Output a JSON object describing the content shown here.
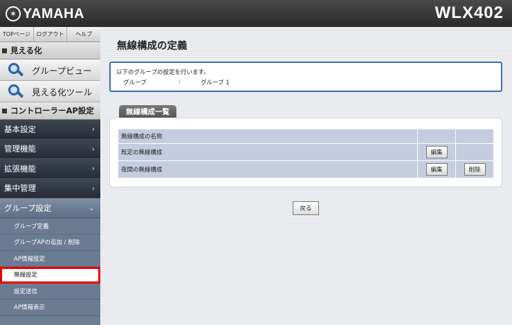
{
  "header": {
    "brand": "YAMAHA",
    "model": "WLX402"
  },
  "sidebar": {
    "toplinks": [
      "TOPページ",
      "ログアウト",
      "ヘルプ"
    ],
    "section_visualize": "見える化",
    "tools": [
      "グループビュー",
      "見える化ツール"
    ],
    "section_controller": "コントローラーAP設定",
    "nav": [
      "基本設定",
      "管理機能",
      "拡張機能",
      "集中管理"
    ],
    "group_settings": "グループ設定",
    "sub_items": [
      "グループ定義",
      "グループAPの追加 / 削除",
      "AP情報設定",
      "無線設定",
      "設定送信",
      "AP情報表示"
    ]
  },
  "main": {
    "title": "無線構成の定義",
    "info_line1": "以下のグループの設定を行います。",
    "info_key": "グループ",
    "info_colon": ":",
    "info_value": "グループ 1",
    "tab_label": "無線構成一覧",
    "table_header": "無線構成の名称",
    "rows": [
      {
        "name": "既定の無線構成",
        "edit": "編集"
      },
      {
        "name": "夜間の無線構成",
        "edit": "編集",
        "delete": "削除"
      }
    ],
    "back_label": "戻る"
  }
}
